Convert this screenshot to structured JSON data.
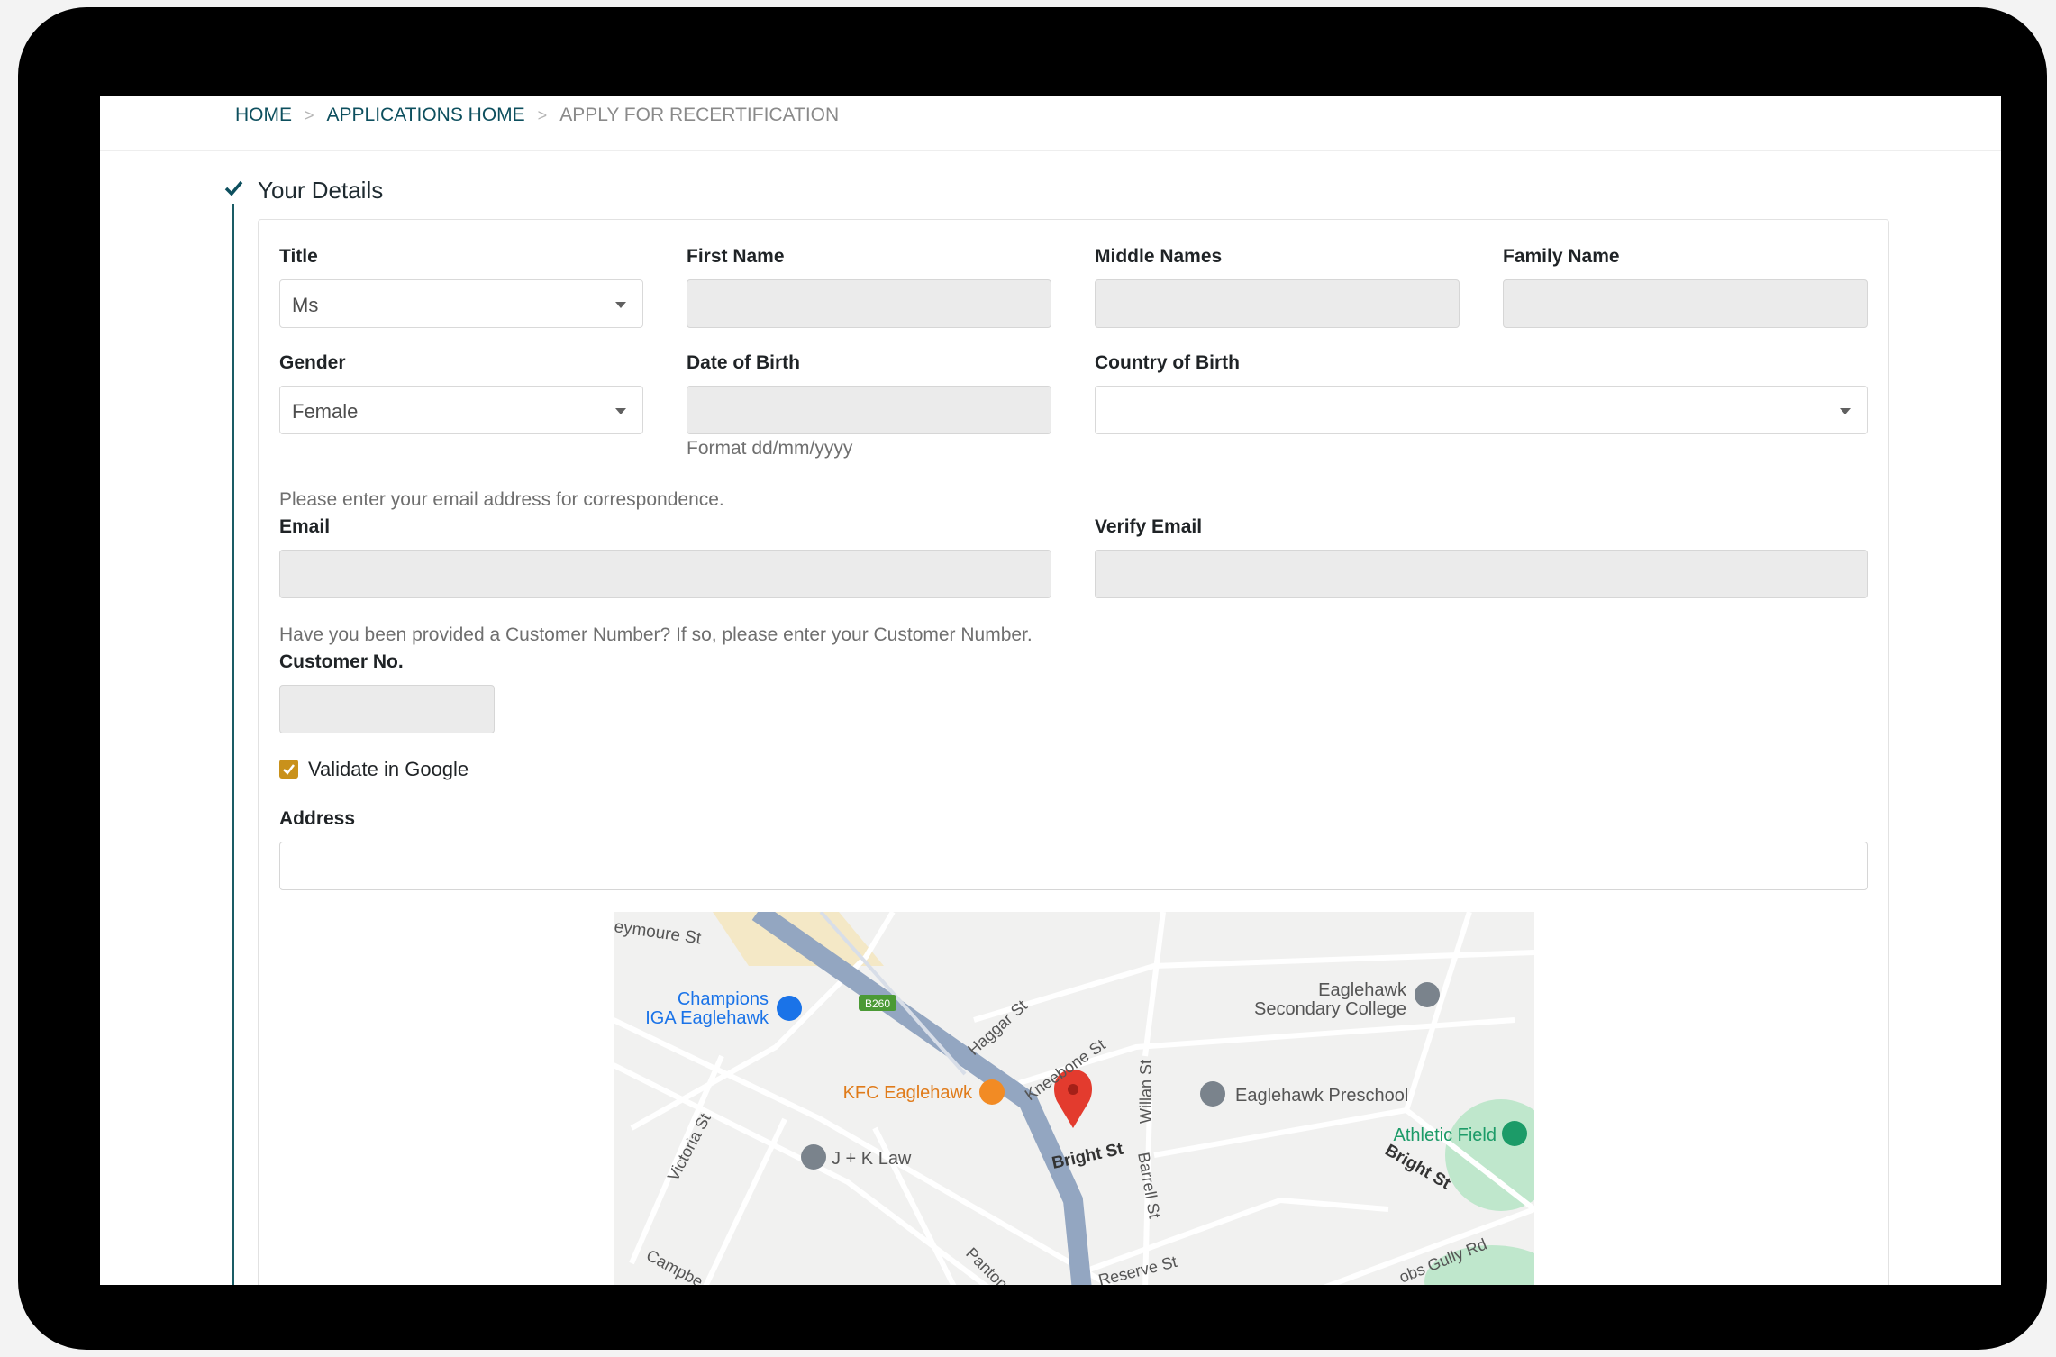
{
  "breadcrumb": {
    "home": "HOME",
    "applications_home": "APPLICATIONS HOME",
    "current": "APPLY FOR RECERTIFICATION",
    "separator": ">"
  },
  "section": {
    "title": "Your Details"
  },
  "form": {
    "title_label": "Title",
    "title_value": "Ms",
    "first_name_label": "First Name",
    "middle_names_label": "Middle Names",
    "family_name_label": "Family Name",
    "gender_label": "Gender",
    "gender_value": "Female",
    "dob_label": "Date of Birth",
    "dob_hint": "Format dd/mm/yyyy",
    "country_label": "Country of Birth",
    "country_value": "",
    "email_hint": "Please enter your email address for correspondence.",
    "email_label": "Email",
    "verify_email_label": "Verify Email",
    "customer_hint": "Have you been provided a Customer Number? If so, please enter your Customer Number.",
    "customer_label": "Customer No.",
    "validate_label": "Validate in Google",
    "validate_checked": true,
    "address_label": "Address"
  },
  "map": {
    "labels": {
      "seymoure_st": "eymoure St",
      "champions": "Champions",
      "iga_eaglehawk": "IGA Eaglehawk",
      "b260": "B260",
      "haggar_st": "Haggar St",
      "eaglehawk": "Eaglehawk",
      "secondary_college": "Secondary College",
      "kneebone_st": "Kneebone St",
      "willan_st": "Willan St",
      "kfc": "KFC Eaglehawk",
      "preschool": "Eaglehawk Preschool",
      "athletic_field": "Athletic Field",
      "victoria_st": "Victoria St",
      "jk_law": "J + K Law",
      "bright_st": "Bright St",
      "barrell_st": "Barrell St",
      "bright_st_east": "Bright St",
      "campbell": "Campbe",
      "panton": "Panton",
      "reserve_st": "Reserve St",
      "jobs_gully_rd": "obs Gully Rd"
    },
    "colors": {
      "road": "#ffffff",
      "main_road": "#93a6c1",
      "park": "#bfe7cc",
      "water_tint": "#f4e8c6",
      "marker": "#e33b2e",
      "poi_blue": "#1a73e8",
      "poi_orange": "#f28b24",
      "poi_gray": "#7a838c",
      "poi_green": "#1c9b68"
    }
  }
}
